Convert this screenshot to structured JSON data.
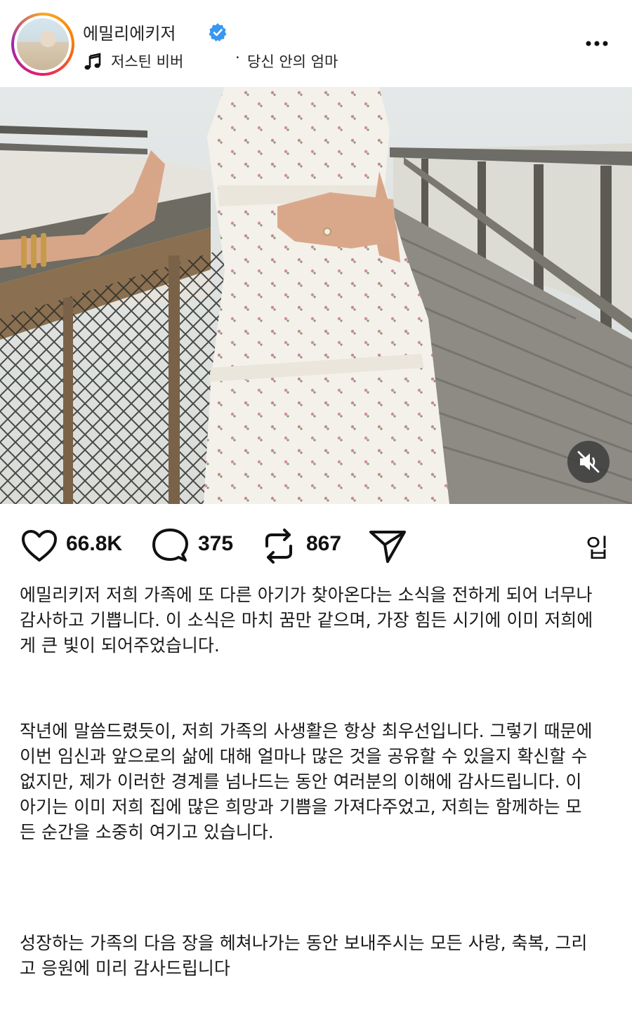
{
  "header": {
    "username": "에밀리에키저",
    "song": "저스틴 비버",
    "separator": "·",
    "song_secondary": "당신 안의 엄마"
  },
  "actions": {
    "likes": "66.8K",
    "comments": "375",
    "reposts": "867",
    "save_label": "입"
  },
  "caption": {
    "paragraph1": "에밀리키저 저희 가족에 또 다른 아기가 찾아온다는 소식을 전하게 되어 너무나 감사하고 기쁩니다. 이 소식은 마치 꿈만 같으며, 가장 힘든 시기에 이미 저희에게 큰 빛이 되어주었습니다.",
    "paragraph2": "작년에 말씀드렸듯이, 저희 가족의 사생활은 항상 최우선입니다. 그렇기 때문에 이번 임신과 앞으로의 삶에 대해 얼마나 많은 것을 공유할 수 있을지 확신할 수 없지만, 제가 이러한 경계를 넘나드는 동안 여러분의 이해에 감사드립니다. 이 아기는 이미 저희 집에 많은 희망과 기쁨을 가져다주었고, 저희는 함께하는 모든 순간을 소중히 여기고 있습니다.",
    "paragraph3": "성장하는 가족의 다음 장을 헤쳐나가는 동안 보내주시는 모든 사랑, 축복, 그리고 응원에 미리 감사드립니다"
  },
  "icons": {
    "verified": "verified-badge-icon",
    "music": "music-note-icon",
    "more": "more-options-icon",
    "mute": "speaker-muted-icon",
    "like": "heart-icon",
    "comment": "comment-icon",
    "repost": "repost-icon",
    "share": "send-icon"
  },
  "colors": {
    "verified": "#3897f0",
    "text": "#111111"
  }
}
